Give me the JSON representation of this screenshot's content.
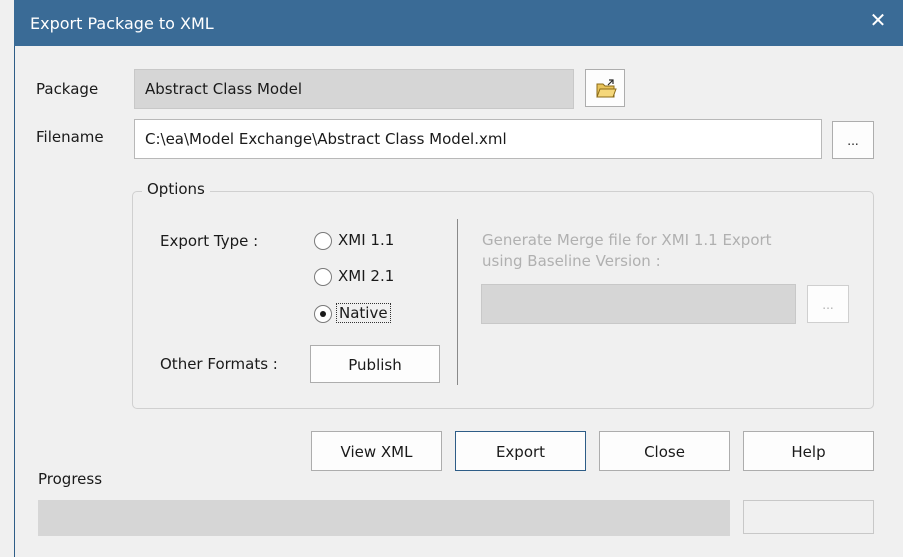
{
  "window": {
    "title": "Export Package to XML",
    "close_glyph": "✕"
  },
  "package": {
    "label": "Package",
    "value": "Abstract Class Model",
    "browse_icon": "folder-open-icon"
  },
  "filename": {
    "label": "Filename",
    "value": "C:\\ea\\Model Exchange\\Abstract Class Model.xml",
    "browse_label": "..."
  },
  "options": {
    "legend": "Options",
    "export_type_label": "Export Type :",
    "export_types": [
      {
        "label": "XMI 1.1",
        "selected": false
      },
      {
        "label": "XMI 2.1",
        "selected": false
      },
      {
        "label": "Native",
        "selected": true
      }
    ],
    "other_formats_label": "Other Formats :",
    "publish_label": "Publish",
    "merge_text_line1": "Generate Merge file for XMI 1.1 Export",
    "merge_text_line2": "using Baseline Version :",
    "merge_value": "",
    "merge_browse_label": "..."
  },
  "buttons": {
    "view_xml": "View XML",
    "export": "Export",
    "close": "Close",
    "help": "Help"
  },
  "progress": {
    "label": "Progress",
    "value": 0,
    "status_text": ""
  },
  "colors": {
    "titlebar": "#3a6b96",
    "dialog_bg": "#f0f0f0",
    "readonly_field": "#d6d6d6"
  }
}
